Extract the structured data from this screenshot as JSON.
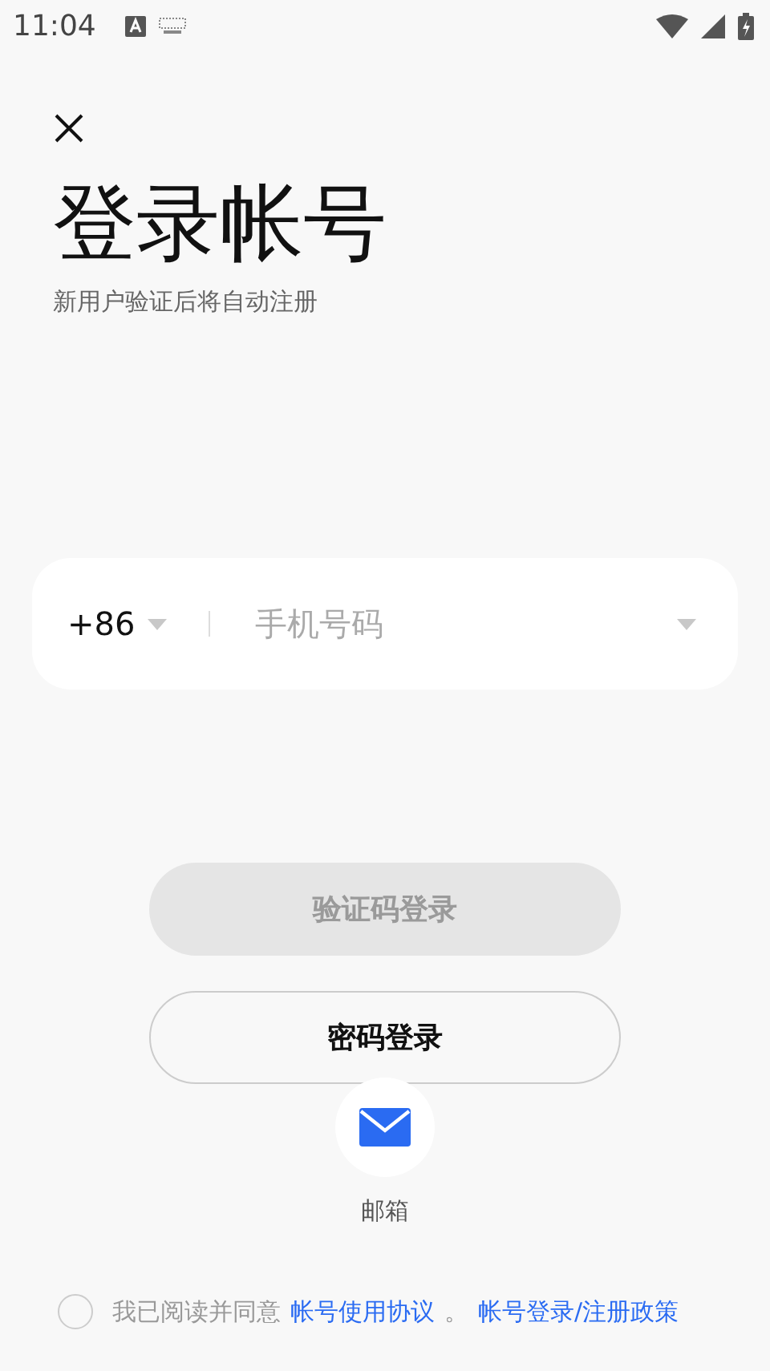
{
  "status_bar": {
    "time": "11:04"
  },
  "title": "登录帐号",
  "subtitle": "新用户验证后将自动注册",
  "phone": {
    "country_code": "+86",
    "placeholder": "手机号码"
  },
  "buttons": [
    {
      "label": "验证码登录",
      "kind": "filled",
      "disabled": true
    },
    {
      "label": "密码登录",
      "kind": "outline",
      "disabled": false
    }
  ],
  "other_login": {
    "label": "邮箱"
  },
  "agreement": {
    "checked": false,
    "text": "我已阅读并同意",
    "links": [
      "帐号使用协议",
      "帐号登录/注册政策"
    ],
    "separator": "。"
  }
}
